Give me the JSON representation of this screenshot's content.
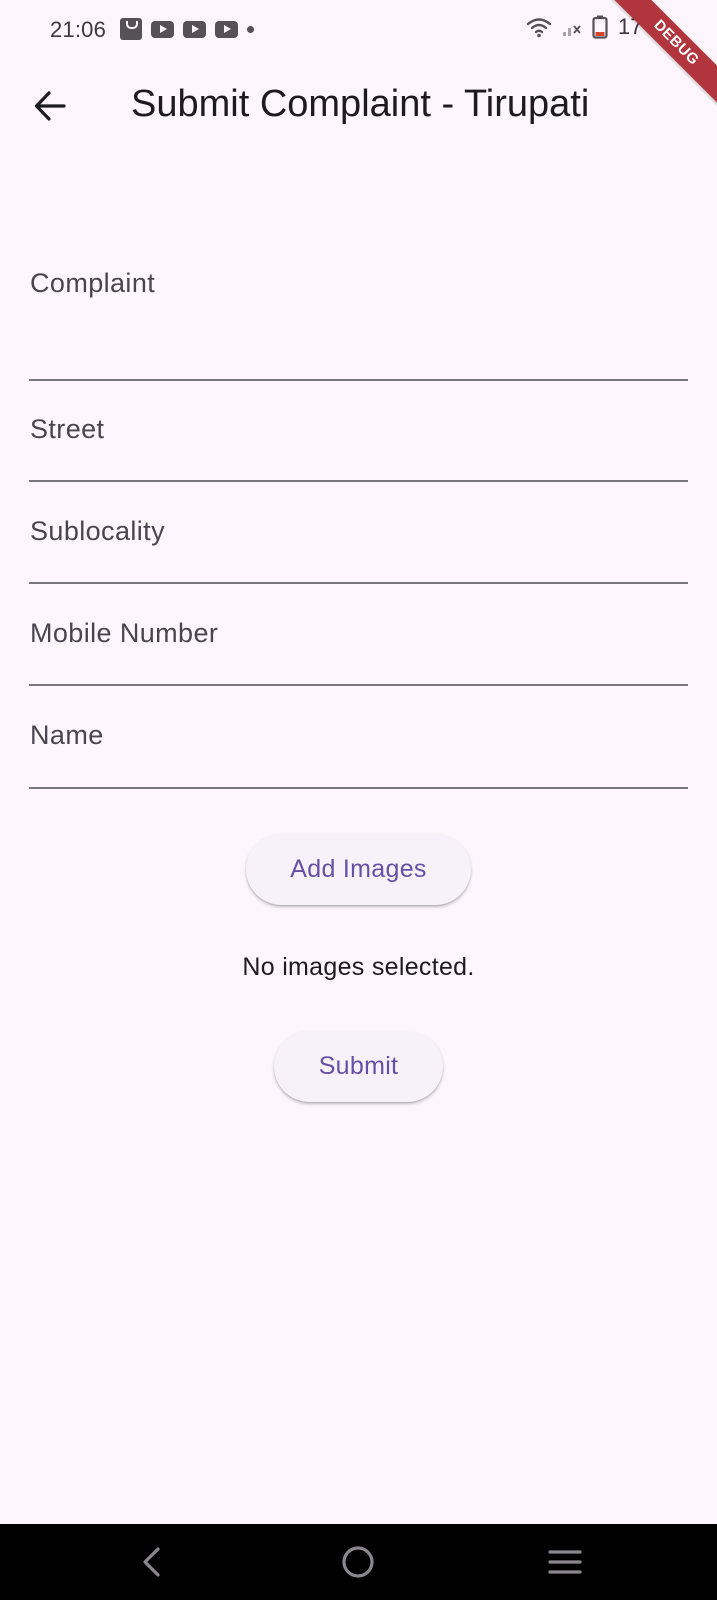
{
  "status_bar": {
    "time": "21:06",
    "battery_text": "17",
    "notification_icons": [
      "bag-icon",
      "youtube-icon",
      "youtube-icon",
      "youtube-icon",
      "dot-icon"
    ],
    "system_icons": [
      "wifi-icon",
      "signal-icon",
      "battery-icon"
    ]
  },
  "debug_banner": {
    "label": "DEBUG",
    "color": "#b2343d"
  },
  "app_bar": {
    "back_icon": "arrow-back-icon",
    "title": "Submit Complaint - Tirupati"
  },
  "form": {
    "fields": [
      {
        "label": "Complaint",
        "value": ""
      },
      {
        "label": "Street",
        "value": ""
      },
      {
        "label": "Sublocality",
        "value": ""
      },
      {
        "label": "Mobile Number",
        "value": ""
      },
      {
        "label": "Name",
        "value": ""
      }
    ],
    "add_images_label": "Add Images",
    "no_images_text": "No images selected.",
    "submit_label": "Submit"
  },
  "nav_bar": {
    "buttons": [
      "back-icon",
      "home-icon",
      "recents-icon"
    ]
  },
  "colors": {
    "background": "#fdf7fd",
    "accent": "#6750a4",
    "button_background": "#f7f2fa",
    "nav_bar": "#000000"
  }
}
